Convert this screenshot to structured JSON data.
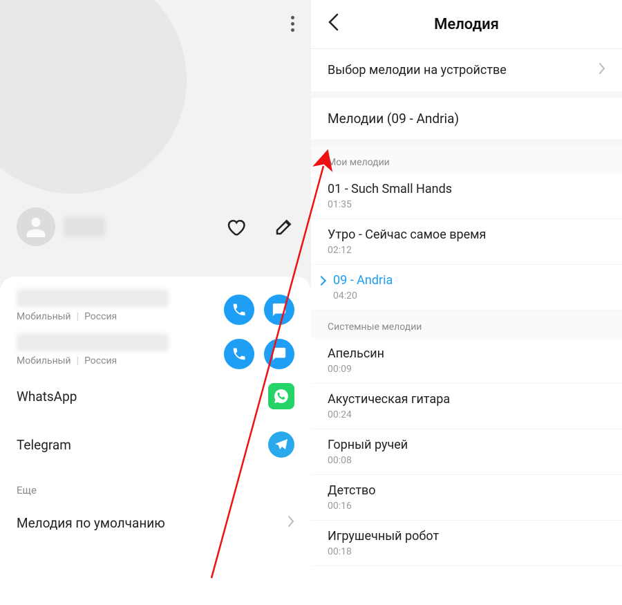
{
  "left": {
    "phones": [
      {
        "type": "Мобильный",
        "country": "Россия"
      },
      {
        "type": "Мобильный",
        "country": "Россия"
      }
    ],
    "apps": {
      "whatsapp": "WhatsApp",
      "telegram": "Telegram"
    },
    "more_label": "Еще",
    "default_ringtone_label": "Мелодия по умолчанию"
  },
  "right": {
    "title": "Мелодия",
    "device_row": "Выбор мелодии на устройстве",
    "current": "Мелодии (09 - Andria)",
    "groups": {
      "my": {
        "label": "Мои мелодии",
        "items": [
          {
            "name": "01 - Such Small Hands",
            "dur": "01:35",
            "selected": false
          },
          {
            "name": "Утро - Сейчас самое время",
            "dur": "02:12",
            "selected": false
          },
          {
            "name": "09 - Andria",
            "dur": "04:20",
            "selected": true
          }
        ]
      },
      "system": {
        "label": "Системные мелодии",
        "items": [
          {
            "name": "Апельсин",
            "dur": "00:09"
          },
          {
            "name": "Акустическая гитара",
            "dur": "00:24"
          },
          {
            "name": "Горный ручей",
            "dur": "00:08"
          },
          {
            "name": "Детство",
            "dur": "00:16"
          },
          {
            "name": "Игрушечный робот",
            "dur": "00:18"
          }
        ]
      }
    }
  }
}
